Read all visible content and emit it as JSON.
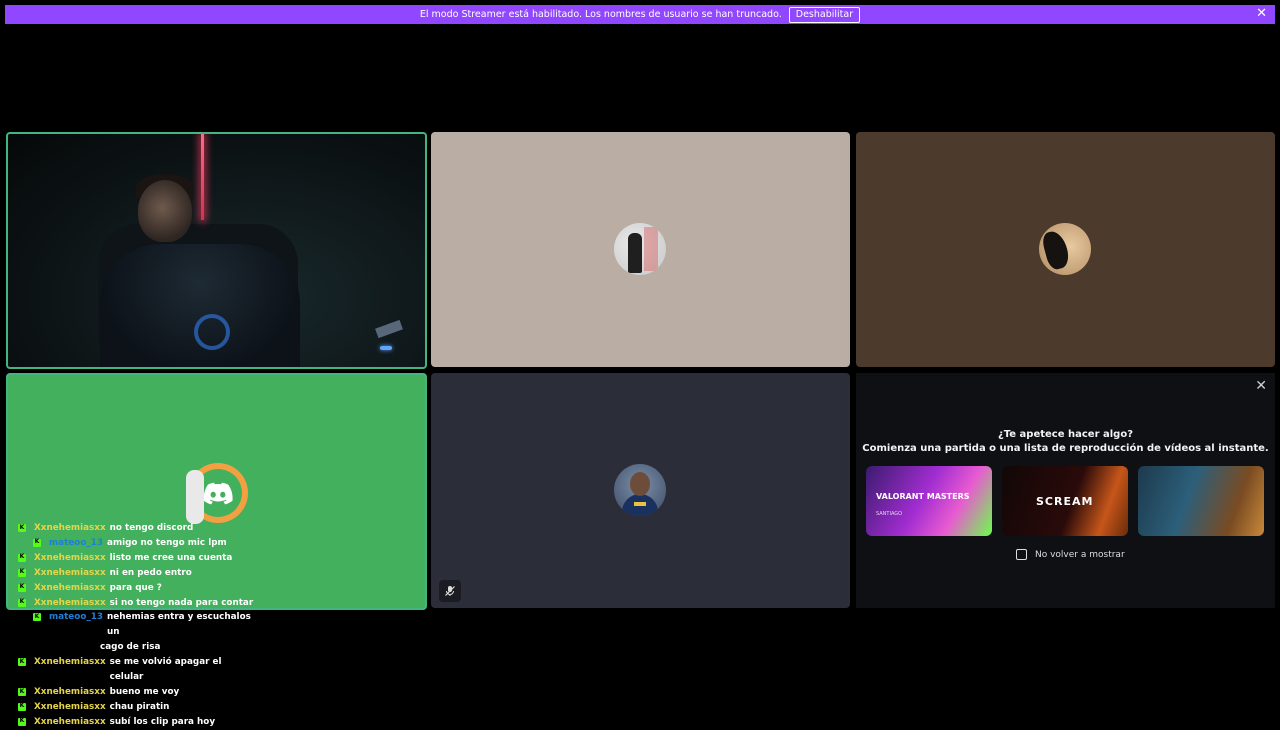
{
  "banner": {
    "message": "El modo Streamer está habilitado. Los nombres de usuario se han truncado.",
    "button_label": "Deshabilitar",
    "close_icon": "close-icon"
  },
  "tiles": {
    "tile1": {
      "kind": "webcam-video",
      "speaking": true
    },
    "tile2": {
      "kind": "avatar"
    },
    "tile3": {
      "kind": "avatar"
    },
    "tile4": {
      "kind": "discord-avatar",
      "speaking": true
    },
    "tile5": {
      "kind": "avatar",
      "muted_icon": "mic-muted-icon"
    }
  },
  "activity": {
    "title": "¿Te apetece hacer algo?",
    "subtitle": "Comienza una partida o una lista de reproducción de vídeos al instante.",
    "cards": [
      {
        "label": "VALORANT MASTERS",
        "sublabel": "SANTIAGO"
      },
      {
        "label": "SCREAM"
      },
      {
        "label": ""
      }
    ],
    "checkbox_label": "No volver a mostrar"
  },
  "chat": [
    {
      "user": "Xxnehemiasxx",
      "text": "no tengo discord",
      "indent": false,
      "color": "#e5d54b"
    },
    {
      "user": "mateoo_13",
      "text": "amigo no tengo mic lpm",
      "indent": true,
      "color": "#1f7fd6"
    },
    {
      "user": "Xxnehemiasxx",
      "text": "listo me cree una cuenta",
      "indent": false,
      "color": "#e5d54b"
    },
    {
      "user": "Xxnehemiasxx",
      "text": "ni en pedo entro",
      "indent": false,
      "color": "#e5d54b"
    },
    {
      "user": "Xxnehemiasxx",
      "text": "para que ?",
      "indent": false,
      "color": "#e5d54b"
    },
    {
      "user": "Xxnehemiasxx",
      "text": "si no tengo nada para contar",
      "indent": false,
      "color": "#e5d54b"
    },
    {
      "user": "mateoo_13",
      "text": "nehemias entra y escuchalos un",
      "indent": true,
      "color": "#1f7fd6",
      "cont": "cago de risa"
    },
    {
      "user": "Xxnehemiasxx",
      "text": "se me volvió apagar el celular",
      "indent": false,
      "color": "#e5d54b"
    },
    {
      "user": "Xxnehemiasxx",
      "text": "bueno me voy",
      "indent": false,
      "color": "#e5d54b"
    },
    {
      "user": "Xxnehemiasxx",
      "text": "chau piratin",
      "indent": false,
      "color": "#e5d54b"
    },
    {
      "user": "Xxnehemiasxx",
      "text": "subí los clip para hoy",
      "indent": false,
      "color": "#e5d54b"
    }
  ]
}
